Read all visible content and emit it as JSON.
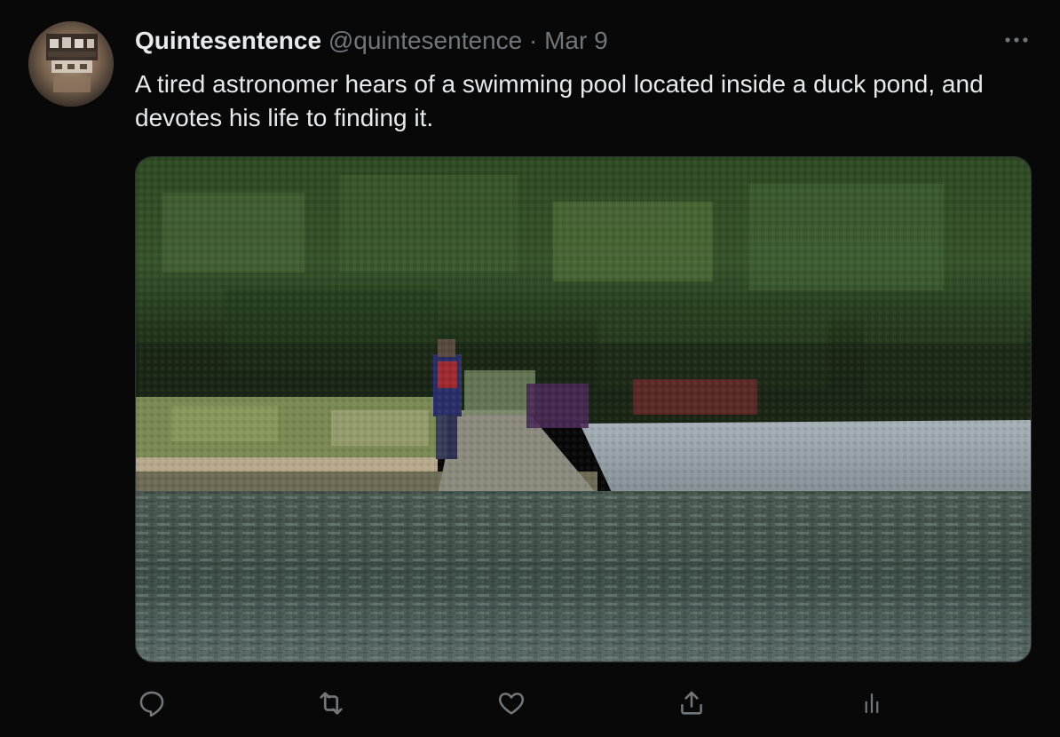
{
  "tweet": {
    "display_name": "Quintesentence",
    "handle": "@quintesentence",
    "separator": "·",
    "date": "Mar 9",
    "text": "A tired astronomer hears of a swimming pool located inside a duck pond, and devotes his life to finding it."
  },
  "media": {
    "description_icon": "photo"
  },
  "actions": [
    {
      "name": "reply",
      "icon": "reply-icon"
    },
    {
      "name": "retweet",
      "icon": "retweet-icon"
    },
    {
      "name": "like",
      "icon": "heart-icon"
    },
    {
      "name": "share",
      "icon": "share-icon"
    },
    {
      "name": "analytics",
      "icon": "analytics-icon"
    }
  ],
  "colors": {
    "background": "#080809",
    "primary_text": "#e7e9ea",
    "secondary_text": "#71767b"
  }
}
